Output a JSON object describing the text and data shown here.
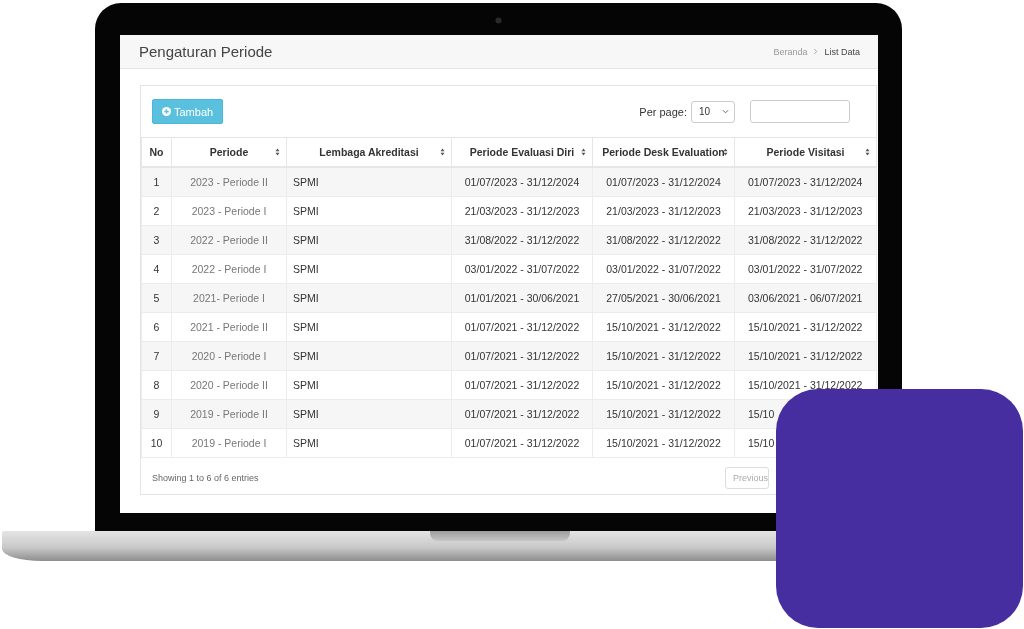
{
  "header": {
    "title": "Pengaturan Periode",
    "breadcrumb": [
      {
        "label": "Beranda",
        "selected": false
      },
      {
        "label": "List Data",
        "selected": true
      }
    ]
  },
  "toolbar": {
    "add_button": "Tambah",
    "per_page_label": "Per page:",
    "per_page_value": "10"
  },
  "table": {
    "columns": [
      {
        "label": "No",
        "sortable": false
      },
      {
        "label": "Periode",
        "sortable": true
      },
      {
        "label": "Lembaga Akreditasi",
        "sortable": true
      },
      {
        "label": "Periode Evaluasi Diri",
        "sortable": true
      },
      {
        "label": "Periode Desk Evaluation",
        "sortable": true
      },
      {
        "label": "Periode Visitasi",
        "sortable": true
      }
    ],
    "rows": [
      [
        "1",
        "2023 - Periode II",
        "SPMI",
        "01/07/2023 - 31/12/2024",
        "01/07/2023 - 31/12/2024",
        "01/07/2023 - 31/12/2024"
      ],
      [
        "2",
        "2023 - Periode I",
        "SPMI",
        "21/03/2023 - 31/12/2023",
        "21/03/2023 - 31/12/2023",
        "21/03/2023 - 31/12/2023"
      ],
      [
        "3",
        "2022 - Periode II",
        "SPMI",
        "31/08/2022 - 31/12/2022",
        "31/08/2022 - 31/12/2022",
        "31/08/2022 - 31/12/2022"
      ],
      [
        "4",
        "2022 - Periode I",
        "SPMI",
        "03/01/2022 - 31/07/2022",
        "03/01/2022 - 31/07/2022",
        "03/01/2022 - 31/07/2022"
      ],
      [
        "5",
        "2021- Periode I",
        "SPMI",
        "01/01/2021 - 30/06/2021",
        "27/05/2021 - 30/06/2021",
        "03/06/2021 - 06/07/2021"
      ],
      [
        "6",
        "2021 - Periode II",
        "SPMI",
        "01/07/2021 - 31/12/2022",
        "15/10/2021 - 31/12/2022",
        "15/10/2021 - 31/12/2022"
      ],
      [
        "7",
        "2020 - Periode I",
        "SPMI",
        "01/07/2021 - 31/12/2022",
        "15/10/2021 - 31/12/2022",
        "15/10/2021 - 31/12/2022"
      ],
      [
        "8",
        "2020 - Periode II",
        "SPMI",
        "01/07/2021 - 31/12/2022",
        "15/10/2021 - 31/12/2022",
        "15/10/2021 - 31/12/2022"
      ],
      [
        "9",
        "2019 - Periode II",
        "SPMI",
        "01/07/2021 - 31/12/2022",
        "15/10/2021 - 31/12/2022",
        "15/10"
      ],
      [
        "10",
        "2019 - Periode I",
        "SPMI",
        "01/07/2021 - 31/12/2022",
        "15/10/2021 - 31/12/2022",
        "15/10"
      ]
    ]
  },
  "footer": {
    "info": "Showing 1 to 6 of 6 entries",
    "pagination": [
      {
        "label": "Previous",
        "disabled": true
      }
    ]
  }
}
